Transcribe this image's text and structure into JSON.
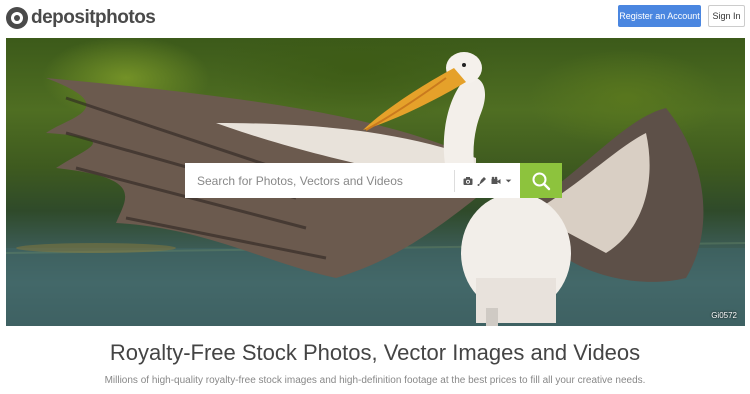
{
  "header": {
    "logo_text": "depositphotos",
    "register_label": "Register an Account",
    "signin_label": "Sign In"
  },
  "search": {
    "placeholder": "Search for Photos, Vectors and Videos",
    "type_icons": [
      "camera-icon",
      "vector-pen-icon",
      "video-camera-icon",
      "chevron-down-icon"
    ],
    "button_icon": "magnifier-icon"
  },
  "hero": {
    "credit": "Gi0572"
  },
  "main": {
    "title": "Royalty-Free Stock Photos, Vector Images and Videos",
    "subtitle": "Millions of high-quality royalty-free stock images and high-definition footage at the best prices to fill all your creative needs."
  },
  "colors": {
    "register_button": "#4a86e0",
    "search_button": "#8dc33d"
  }
}
